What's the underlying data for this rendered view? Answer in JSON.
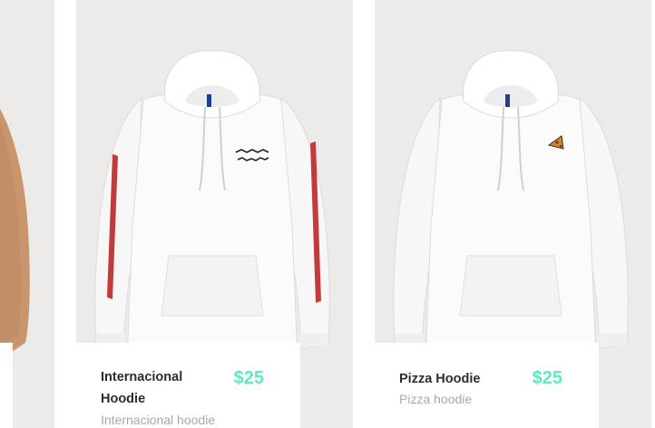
{
  "products": [
    {
      "name": "",
      "price": "",
      "subtitle": "",
      "image": "beige-sweater-image"
    },
    {
      "name": "Internacional Hoodie",
      "price": "$25",
      "subtitle": "Internacional hoodie",
      "image": "white-hoodie-red-sleeve-stripes-image"
    },
    {
      "name": "Pizza Hoodie",
      "price": "$25",
      "subtitle": "Pizza hoodie",
      "image": "white-hoodie-pizza-patch-image"
    }
  ],
  "colors": {
    "card_background": "#ecebe9",
    "price": "#5fe8c4",
    "name": "#2d2d2d",
    "subtitle": "#a9a9a9",
    "sweater": "#c8956d",
    "stripe": "#c23a3a"
  }
}
